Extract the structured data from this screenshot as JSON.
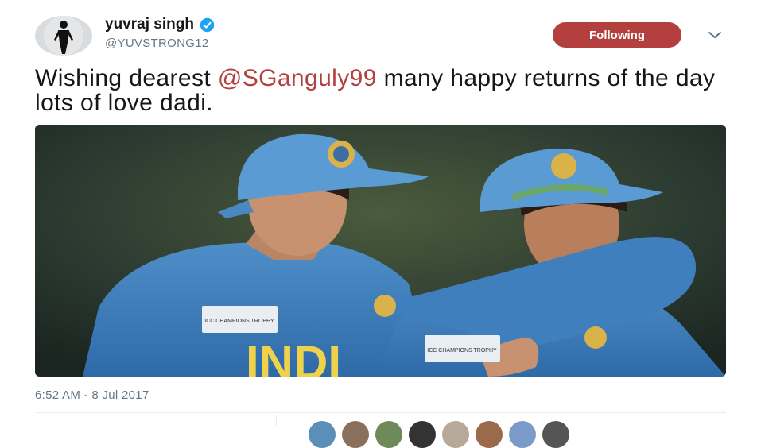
{
  "tweet": {
    "author": {
      "name": "yuvraj singh",
      "handle": "@YUVSTRONG12",
      "verified": true,
      "avatar_icon": "avatar-silhouette"
    },
    "follow_button_label": "Following",
    "text_before": "Wishing dearest ",
    "mention": "@SGanguly99",
    "text_after": " many happy returns of the day lots of love dadi.",
    "timestamp": "6:52 AM - 8 Jul 2017",
    "media": {
      "jersey_text": "INDI",
      "badge_text_left": "ICC CHAMPIONS TROPHY",
      "badge_text_right": "ICC CHAMPIONS TROPHY"
    }
  },
  "colors": {
    "accent": "#b3403e",
    "verified": "#1da1f2",
    "muted": "#657786"
  }
}
